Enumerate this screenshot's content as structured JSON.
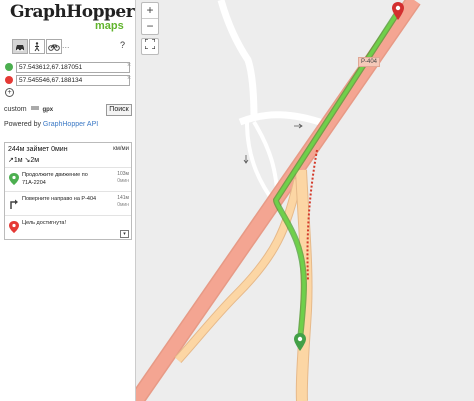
{
  "header": {
    "logo_text": "GraphHopper",
    "logo_sub": "maps"
  },
  "vehicles": [
    {
      "name": "car",
      "icon": "car-icon",
      "active": true
    },
    {
      "name": "foot",
      "icon": "walk-icon",
      "active": false
    },
    {
      "name": "bike",
      "icon": "bike-icon",
      "active": false
    }
  ],
  "more_label": "...",
  "help_label": "?",
  "points": {
    "from": {
      "value": "57.543612,67.187051",
      "color": "#4caf50"
    },
    "to": {
      "value": "57.545546,67.188134",
      "color": "#e53935"
    }
  },
  "remove_label": "×",
  "add_point_label": "+",
  "custom_label": "custom",
  "gpx_label": "gpx",
  "search_button": "Поиск",
  "powered": {
    "prefix": "Powered by ",
    "link": "GraphHopper API"
  },
  "instructions": {
    "summary_line1": "244м займет 0мин",
    "summary_line2": "↗1м ↘2м",
    "units_toggle": "км/ми",
    "steps": [
      {
        "icon": "start-marker-icon",
        "text": "Продолжите движение по 71А-2204",
        "distance": "103м",
        "time": "0мин"
      },
      {
        "icon": "turn-right-icon",
        "text": "Поверните направо на Р-404",
        "distance": "141м",
        "time": "0мин"
      },
      {
        "icon": "finish-marker-icon",
        "text": "Цель достигнута!",
        "distance": "",
        "time": ""
      }
    ],
    "expand_label": "▾"
  },
  "map": {
    "zoom_in": "+",
    "zoom_out": "−",
    "fullscreen": "⛶",
    "road_label": "Р-404",
    "colors": {
      "trunk": "#f4a592",
      "primary": "#fcd6a4",
      "route": "#5cbf3f",
      "background": "#ededed"
    }
  }
}
